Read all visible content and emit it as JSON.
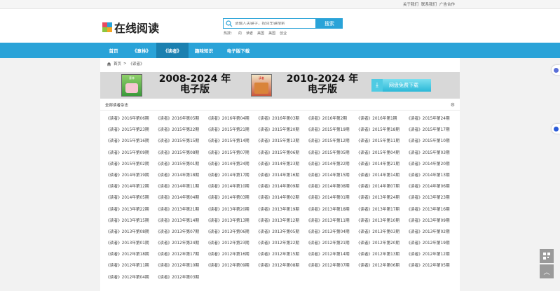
{
  "top_links": [
    "关于我们",
    "联系我们",
    "广告合作"
  ],
  "logo": {
    "text": "在线阅读",
    "colors": [
      "#e84a5f",
      "#2aa3d8",
      "#8cc63f",
      "#f5a623"
    ]
  },
  "search": {
    "placeholder": "请输入关键字，按回车键搜索",
    "button": "搜索"
  },
  "hot": {
    "label": "热搜：",
    "items": [
      "的",
      "读者",
      "美国",
      "美国",
      "创业"
    ]
  },
  "nav": {
    "items": [
      "首页",
      "《意林》",
      "《读者》",
      "趣味知识",
      "电子版下载"
    ],
    "active_index": 2
  },
  "breadcrumb": {
    "home": "首页",
    "sep": ">",
    "current": "《读者》"
  },
  "banner": {
    "left_years": "2008-2024 年",
    "left_sub": "电子版",
    "right_years": "2010-2024 年",
    "right_sub": "电子版",
    "book1_label": "意林",
    "book2_label": "读者",
    "download_button": "网盘免费下载"
  },
  "section_title": "全部读者杂志",
  "magazines": [
    "《读者》2016年第06期",
    "《读者》2016年第05期",
    "《读者》2016年第04期",
    "《读者》2016年第03期",
    "《读者》2016年第2期",
    "《读者》2016年第1期",
    "《读者》2015年第24期",
    "《读者》2015年第23期",
    "《读者》2015年第22期",
    "《读者》2015年第21期",
    "《读者》2015年第20期",
    "《读者》2015年第19期",
    "《读者》2015年第18期",
    "《读者》2015年第17期",
    "《读者》2015年第16期",
    "《读者》2015年第15期",
    "《读者》2015年第14期",
    "《读者》2015年第13期",
    "《读者》2015年第12期",
    "《读者》2015年第11期",
    "《读者》2015年第10期",
    "《读者》2015年第09期",
    "《读者》2015年第08期",
    "《读者》2015年第07期",
    "《读者》2015年第06期",
    "《读者》2015年第05期",
    "《读者》2015年第04期",
    "《读者》2015年第03期",
    "《读者》2015年第02期",
    "《读者》2015年第01期",
    "《读者》2014年第24期",
    "《读者》2014年第23期",
    "《读者》2014年第22期",
    "《读者》2014年第21期",
    "《读者》2014年第20期",
    "《读者》2014年第19期",
    "《读者》2014年第18期",
    "《读者》2014年第17期",
    "《读者》2014年第16期",
    "《读者》2014年第15期",
    "《读者》2014年第14期",
    "《读者》2014年第13期",
    "《读者》2014年第12期",
    "《读者》2014年第11期",
    "《读者》2014年第10期",
    "《读者》2014年第09期",
    "《读者》2014年第08期",
    "《读者》2014年第07期",
    "《读者》2014年第06期",
    "《读者》2014年第05期",
    "《读者》2014年第04期",
    "《读者》2014年第03期",
    "《读者》2014年第02期",
    "《读者》2014年第01期",
    "《读者》2013年第24期",
    "《读者》2013年第23期",
    "《读者》2013年第22期",
    "《读者》2013年第21期",
    "《读者》2013年第20期",
    "《读者》2013年第19期",
    "《读者》2013年第18期",
    "《读者》2013年第17期",
    "《读者》2013年第16期",
    "《读者》2013年第15期",
    "《读者》2013年第14期",
    "《读者》2013年第13期",
    "《读者》2013年第12期",
    "《读者》2013年第11期",
    "《读者》2013年第10期",
    "《读者》2013年第09期",
    "《读者》2013年第08期",
    "《读者》2013年第07期",
    "《读者》2013年第06期",
    "《读者》2013年第05期",
    "《读者》2013年第04期",
    "《读者》2013年第03期",
    "《读者》2013年第02期",
    "《读者》2013年第01期",
    "《读者》2012年第24期",
    "《读者》2012年第23期",
    "《读者》2012年第22期",
    "《读者》2012年第21期",
    "《读者》2012年第20期",
    "《读者》2012年第19期",
    "《读者》2012年第18期",
    "《读者》2012年第17期",
    "《读者》2012年第16期",
    "《读者》2012年第15期",
    "《读者》2012年第14期",
    "《读者》2012年第13期",
    "《读者》2012年第12期",
    "《读者》2012年第11期",
    "《读者》2012年第10期",
    "《读者》2012年第09期",
    "《读者》2012年第08期",
    "《读者》2012年第07期",
    "《读者》2012年第06期",
    "《读者》2012年第05期",
    "《读者》2012年第04期",
    "《读者》2012年第03期"
  ],
  "colors": {
    "accent": "#2aa3d8",
    "nav_active": "#1b80b0"
  }
}
